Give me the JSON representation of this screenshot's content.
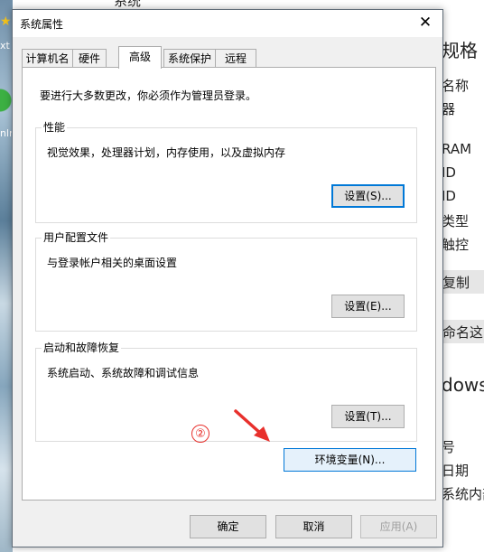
{
  "background": {
    "top_title": "系统",
    "left_texts": [
      "xt",
      "nln"
    ],
    "right_items": [
      "规格",
      "名称",
      "器",
      "RAM",
      "ID",
      "ID",
      "类型",
      "触控",
      "复制",
      "命名这台",
      "dows",
      "号",
      "日期",
      "系统内部"
    ]
  },
  "dialog": {
    "title": "系统属性",
    "close_glyph": "✕",
    "tabs": [
      "计算机名",
      "硬件",
      "高级",
      "系统保护",
      "远程"
    ],
    "intro": "要进行大多数更改，你必须作为管理员登录。",
    "groups": [
      {
        "legend": "性能",
        "desc": "视觉效果，处理器计划，内存使用，以及虚拟内存",
        "button": "设置(S)..."
      },
      {
        "legend": "用户配置文件",
        "desc": "与登录帐户相关的桌面设置",
        "button": "设置(E)..."
      },
      {
        "legend": "启动和故障恢复",
        "desc": "系统启动、系统故障和调试信息",
        "button": "设置(T)..."
      }
    ],
    "env_button": "环境变量(N)...",
    "footer": {
      "ok": "确定",
      "cancel": "取消",
      "apply": "应用(A)"
    }
  },
  "annotation": {
    "number": "②",
    "color": "#e8302c"
  },
  "colors": {
    "accent": "#0078d7"
  }
}
